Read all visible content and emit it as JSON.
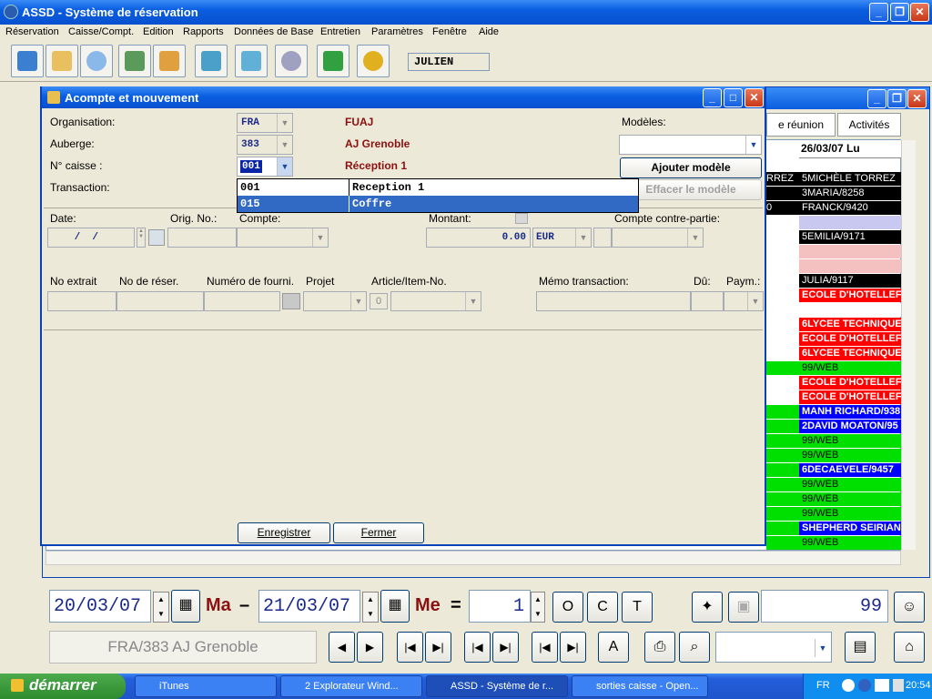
{
  "app": {
    "title": "ASSD - Système de réservation"
  },
  "menu": [
    "Réservation",
    "Caisse/Compt.",
    "Edition",
    "Rapports",
    "Données de Base",
    "Entretien",
    "Paramètres",
    "Fenêtre",
    "Aide"
  ],
  "toolbar": {
    "user": "JULIEN"
  },
  "background_window": {
    "tabs": [
      "e réunion",
      "Activités"
    ],
    "column_header": "26/03/07 Lu",
    "left_cells": [
      "RREZ",
      "",
      "0"
    ],
    "rows": [
      {
        "text": "5MICHÈLE TORREZ",
        "bg": "#000000",
        "fg": "#ffffff"
      },
      {
        "text": "3MARIA/8258",
        "bg": "#000000",
        "fg": "#ffffff"
      },
      {
        "text": "FRANCK/9420",
        "bg": "#000000",
        "fg": "#ffffff"
      },
      {
        "text": "",
        "bg": "#c8c8f0",
        "fg": "#000000"
      },
      {
        "text": "5EMILIA/9171",
        "bg": "#000000",
        "fg": "#ffffff"
      },
      {
        "text": "",
        "bg": "#f4c0c0",
        "fg": "#000000"
      },
      {
        "text": "",
        "bg": "#f4c0c0",
        "fg": "#000000"
      },
      {
        "text": "JULIA/9117",
        "bg": "#000000",
        "fg": "#ffffff"
      },
      {
        "text": "ECOLE D'HOTELLEF",
        "bg": "#ff0000",
        "fg": "#ffffff"
      },
      {
        "text": "",
        "bg": "#ffffff",
        "fg": "#000000"
      },
      {
        "text": "6LYCEE TECHNIQUE",
        "bg": "#ff0000",
        "fg": "#ffffff"
      },
      {
        "text": "ECOLE D'HOTELLEF",
        "bg": "#ff0000",
        "fg": "#ffffff"
      },
      {
        "text": "6LYCEE TECHNIQUE",
        "bg": "#ff0000",
        "fg": "#ffffff"
      },
      {
        "text": "99/WEB",
        "bg": "#00e000",
        "fg": "#000000"
      },
      {
        "text": "ECOLE D'HOTELLEF",
        "bg": "#ff0000",
        "fg": "#ffffff"
      },
      {
        "text": "ECOLE D'HOTELLEF",
        "bg": "#ff0000",
        "fg": "#ffffff"
      },
      {
        "text": "MANH RICHARD/938",
        "bg": "#0000ff",
        "fg": "#ffffff"
      },
      {
        "text": "2DAVID MOATON/95",
        "bg": "#0000ff",
        "fg": "#ffffff"
      },
      {
        "text": "99/WEB",
        "bg": "#00e000",
        "fg": "#000000"
      },
      {
        "text": "99/WEB",
        "bg": "#00e000",
        "fg": "#000000"
      },
      {
        "text": "6DECAEVELE/9457",
        "bg": "#0000ff",
        "fg": "#ffffff"
      },
      {
        "text": "99/WEB",
        "bg": "#00e000",
        "fg": "#000000"
      },
      {
        "text": "99/WEB",
        "bg": "#00e000",
        "fg": "#000000"
      },
      {
        "text": "99/WEB",
        "bg": "#00e000",
        "fg": "#000000"
      },
      {
        "text": "SHEPHERD SEIRIAN",
        "bg": "#0000ff",
        "fg": "#ffffff"
      },
      {
        "text": "99/WEB",
        "bg": "#00e000",
        "fg": "#000000"
      }
    ]
  },
  "dialog": {
    "title": "Acompte et mouvement",
    "labels": {
      "organisation": "Organisation:",
      "auberge": "Auberge:",
      "caisse": "N° caisse :",
      "transaction": "Transaction:",
      "modeles": "Modèles:",
      "date": "Date:",
      "orig_no": "Orig. No.:",
      "compte": "Compte:",
      "montant": "Montant:",
      "compte_contre": "Compte contre-partie:",
      "no_extrait": "No extrait",
      "no_reser": "No de réser.",
      "num_fourni": "Numéro de fourni.",
      "projet": "Projet",
      "article": "Article/Item-No.",
      "memo": "Mémo transaction:",
      "du": "Dû:",
      "paym": "Paym.:"
    },
    "values": {
      "organisation_code": "FRA",
      "auberge_code": "383",
      "caisse_code": "001",
      "organisation_name": "FUAJ",
      "auberge_name": "AJ Grenoble",
      "caisse_name": "Réception 1",
      "date": " /  / ",
      "montant": "0.00",
      "currency": "EUR",
      "article_zero": "0"
    },
    "buttons": {
      "ajouter": "Ajouter modèle",
      "effacer": "Effacer le modèle",
      "enregistrer": "Enregistrer",
      "fermer": "Fermer"
    },
    "popup": [
      {
        "code": "001",
        "name": "Reception 1"
      },
      {
        "code": "015",
        "name": "Coffre"
      }
    ]
  },
  "bottom": {
    "date_from": "20/03/07",
    "day_from": "Ma",
    "dash": "–",
    "date_to": "21/03/07",
    "day_to": "Me",
    "equals": "=",
    "nights": "1",
    "btn_o": "O",
    "btn_c": "C",
    "btn_t": "T",
    "count": "99",
    "hostel": "FRA/383 AJ Grenoble",
    "btn_a": "A"
  },
  "taskbar": {
    "start": "démarrer",
    "tasks": [
      "iTunes",
      "2 Explorateur Wind...",
      "ASSD - Système de r...",
      "sorties caisse - Open..."
    ],
    "lang": "FR",
    "clock": "20:54"
  }
}
